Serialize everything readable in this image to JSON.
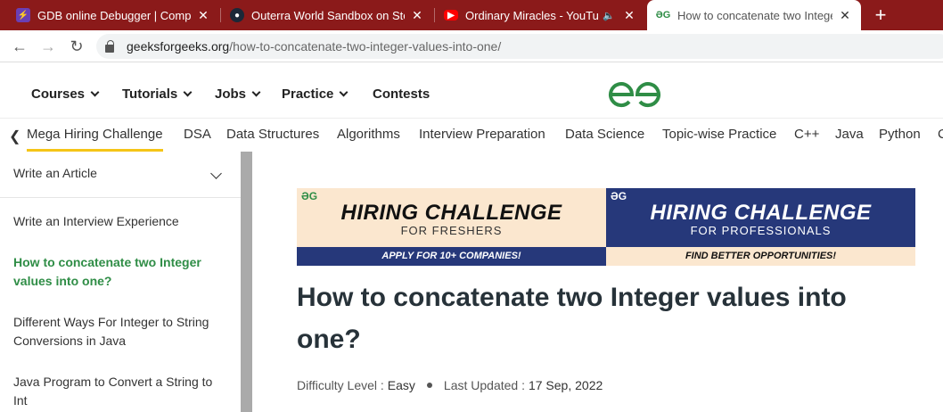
{
  "browser": {
    "tabs": [
      {
        "title": "GDB online Debugger | Compiler",
        "icon": "gdb-icon",
        "color": "#6a3fb5"
      },
      {
        "title": "Outerra World Sandbox on Steam",
        "icon": "steam-icon",
        "color": "#1b2838"
      },
      {
        "title": "Ordinary Miracles - YouTube",
        "icon": "youtube-icon",
        "color": "#ff0000"
      },
      {
        "title": "How to concatenate two Integer",
        "icon": "gfg-icon",
        "color": "#2f8d46"
      }
    ],
    "close_glyph": "✕",
    "new_tab_glyph": "+",
    "url_host": "geeksforgeeks.org",
    "url_path": "/how-to-concatenate-two-integer-values-into-one/"
  },
  "header": {
    "menu": [
      {
        "label": "Courses",
        "has_dropdown": true
      },
      {
        "label": "Tutorials",
        "has_dropdown": true
      },
      {
        "label": "Jobs",
        "has_dropdown": true
      },
      {
        "label": "Practice",
        "has_dropdown": true
      },
      {
        "label": "Contests",
        "has_dropdown": false
      }
    ],
    "brand_color": "#2f8d46"
  },
  "categories": [
    "Mega Hiring Challenge",
    "DSA",
    "Data Structures",
    "Algorithms",
    "Interview Preparation",
    "Data Science",
    "Topic-wise Practice",
    "C++",
    "Java",
    "Python",
    "C"
  ],
  "sidebar": {
    "heading": "Write an Article",
    "links": [
      {
        "label": "Write an Interview Experience",
        "current": false
      },
      {
        "label": "How to concatenate two Integer values into one?",
        "current": true
      },
      {
        "label": "Different Ways For Integer to String Conversions in Java",
        "current": false
      },
      {
        "label": "Java Program to Convert a String to Int",
        "current": false
      }
    ]
  },
  "banner": {
    "left": {
      "logo": "ƏG",
      "title": "HIRING CHALLENGE",
      "subtitle": "FOR FRESHERS",
      "footer": "APPLY FOR 10+ COMPANIES!"
    },
    "right": {
      "logo": "ƏG",
      "title": "HIRING CHALLENGE",
      "subtitle": "FOR PROFESSIONALS",
      "footer": "FIND BETTER OPPORTUNITIES!"
    }
  },
  "article": {
    "title": "How to concatenate two Integer values into one?",
    "difficulty_label": "Difficulty Level :",
    "difficulty": "Easy",
    "updated_label": "Last Updated :",
    "updated": "17 Sep, 2022"
  }
}
